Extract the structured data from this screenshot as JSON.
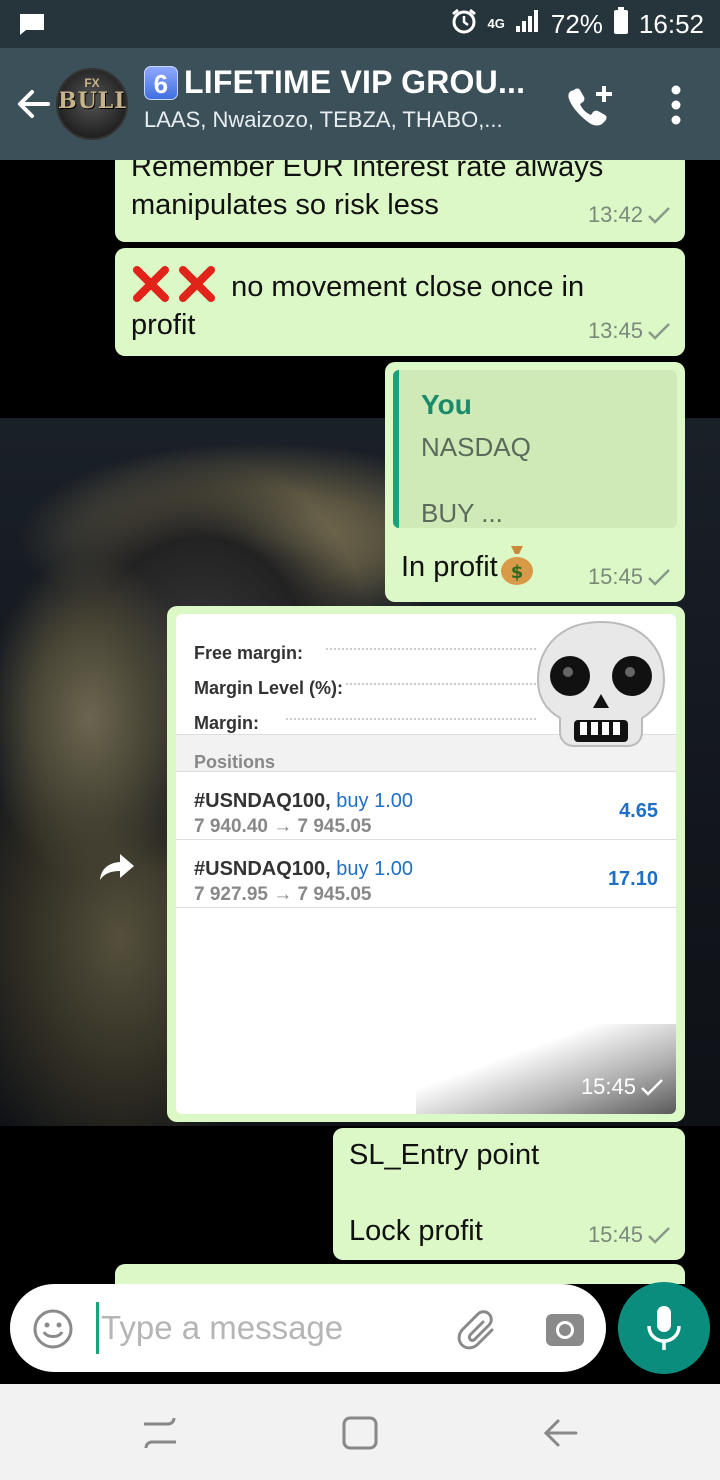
{
  "status_bar": {
    "network_top": "4G",
    "battery": "72%",
    "time": "16:52"
  },
  "header": {
    "group_badge": "6",
    "title": "LIFETIME VIP GROU...",
    "subtitle": "LAAS, Nwaizozo, TEBZA, THABO,...",
    "avatar_top": "FX",
    "avatar_text": "BULLS"
  },
  "messages": [
    {
      "text": "Remember EUR Interest rate always manipulates so risk less",
      "time": "13:42"
    },
    {
      "text": "no movement close once in profit",
      "time": "13:45"
    },
    {
      "quote_author": "You",
      "quote_line1": "NASDAQ",
      "quote_line2": "BUY ...",
      "text": "In profit",
      "time": "15:45"
    },
    {
      "time": "15:45"
    },
    {
      "text_line1": "SL_Entry point",
      "text_line2": "Lock profit",
      "time": "15:45"
    }
  ],
  "screenshot": {
    "account_rows": [
      "Free margin:",
      "Margin Level (%):",
      "Margin:"
    ],
    "positions_header": "Positions",
    "positions": [
      {
        "symbol": "#USNDAQ100,",
        "type": "buy 1.00",
        "prices": "7 940.40 → 7 945.05",
        "profit": "4.65"
      },
      {
        "symbol": "#USNDAQ100,",
        "type": "buy 1.00",
        "prices": "7 927.95 → 7 945.05",
        "profit": "17.10"
      }
    ]
  },
  "input": {
    "placeholder": "Type a message"
  },
  "colors": {
    "header": "#3b5058",
    "bubble": "#dcf8c6",
    "accent": "#0a8d7c",
    "quote_bar": "#1aa37a"
  },
  "icons": [
    "back-arrow-icon",
    "add-call-icon",
    "more-vert-icon",
    "emoji-icon",
    "paperclip-icon",
    "camera-icon",
    "mic-icon",
    "forward-icon",
    "skull-emoji-icon",
    "money-bag-emoji-icon",
    "cross-mark-emoji-icon"
  ]
}
